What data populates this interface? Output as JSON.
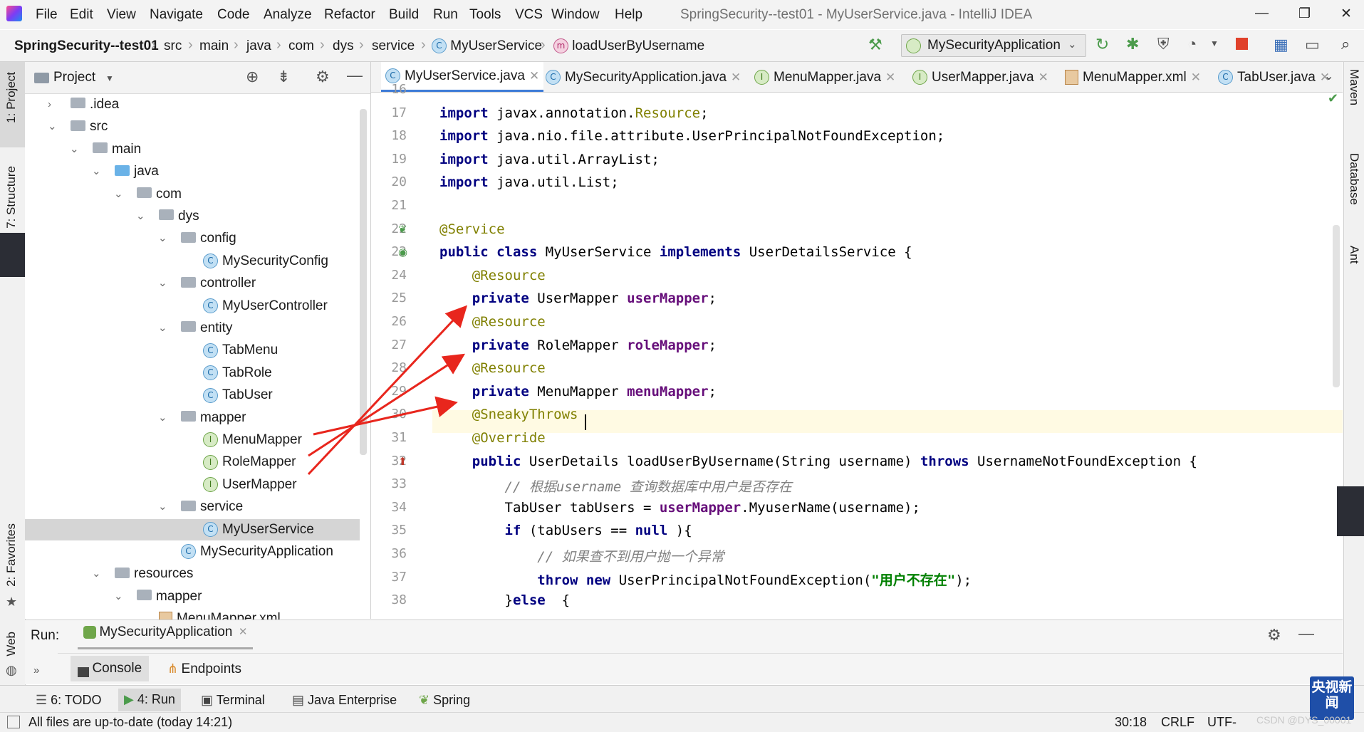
{
  "menu": {
    "items": [
      "File",
      "Edit",
      "View",
      "Navigate",
      "Code",
      "Analyze",
      "Refactor",
      "Build",
      "Run",
      "Tools",
      "VCS",
      "Window",
      "Help"
    ],
    "title": "SpringSecurity--test01 - MyUserService.java - IntelliJ IDEA"
  },
  "window_controls": {
    "minimize": "—",
    "maximize": "❐",
    "close": "✕"
  },
  "breadcrumb": {
    "project": "SpringSecurity--test01",
    "parts": [
      "src",
      "main",
      "java",
      "com",
      "dys",
      "service"
    ],
    "class": "MyUserService",
    "method": "loadUserByUsername"
  },
  "toolbar": {
    "run_config": "MySecurityApplication"
  },
  "left_strip": {
    "project_tab": "1: Project",
    "structure_tab": "7: Structure",
    "favorites_tab": "2: Favorites",
    "web_tab": "Web"
  },
  "right_strip": {
    "maven_tab": "Maven",
    "database_tab": "Database",
    "ant_tab": "Ant"
  },
  "project_panel": {
    "title": "Project",
    "tree": [
      {
        "label": ".idea",
        "kind": "folder",
        "arrow": "›"
      },
      {
        "label": "src",
        "kind": "folder",
        "arrow": "⌄"
      },
      {
        "label": "main",
        "kind": "folder",
        "arrow": "⌄"
      },
      {
        "label": "java",
        "kind": "folder-blue",
        "arrow": "⌄"
      },
      {
        "label": "com",
        "kind": "folder",
        "arrow": "⌄"
      },
      {
        "label": "dys",
        "kind": "folder",
        "arrow": "⌄"
      },
      {
        "label": "config",
        "kind": "folder",
        "arrow": "⌄"
      },
      {
        "label": "MySecurityConfig",
        "kind": "class",
        "arrow": ""
      },
      {
        "label": "controller",
        "kind": "folder",
        "arrow": "⌄"
      },
      {
        "label": "MyUserController",
        "kind": "class",
        "arrow": ""
      },
      {
        "label": "entity",
        "kind": "folder",
        "arrow": "⌄"
      },
      {
        "label": "TabMenu",
        "kind": "class",
        "arrow": ""
      },
      {
        "label": "TabRole",
        "kind": "class",
        "arrow": ""
      },
      {
        "label": "TabUser",
        "kind": "class",
        "arrow": ""
      },
      {
        "label": "mapper",
        "kind": "folder",
        "arrow": "⌄"
      },
      {
        "label": "MenuMapper",
        "kind": "interface",
        "arrow": ""
      },
      {
        "label": "RoleMapper",
        "kind": "interface",
        "arrow": ""
      },
      {
        "label": "UserMapper",
        "kind": "interface",
        "arrow": ""
      },
      {
        "label": "service",
        "kind": "folder",
        "arrow": "⌄"
      },
      {
        "label": "MyUserService",
        "kind": "class",
        "arrow": "",
        "selected": true
      },
      {
        "label": "MySecurityApplication",
        "kind": "class-app",
        "arrow": ""
      },
      {
        "label": "resources",
        "kind": "folder",
        "arrow": "⌄"
      },
      {
        "label": "mapper",
        "kind": "folder",
        "arrow": "⌄"
      },
      {
        "label": "MenuMapper.xml",
        "kind": "xml",
        "arrow": ""
      }
    ]
  },
  "editor_tabs": [
    {
      "label": "MyUserService.java",
      "icon": "C",
      "active": true
    },
    {
      "label": "MySecurityApplication.java",
      "icon": "C"
    },
    {
      "label": "MenuMapper.java",
      "icon": "I"
    },
    {
      "label": "UserMapper.java",
      "icon": "I"
    },
    {
      "label": "MenuMapper.xml",
      "icon": "xml"
    },
    {
      "label": "TabUser.java",
      "icon": "C"
    }
  ],
  "code": {
    "first_line": 16,
    "cursor_line": 30,
    "lines": [
      [],
      [
        [
          "kw",
          "import"
        ],
        [
          "",
          "javax.annotation."
        ],
        [
          "ann",
          "Resource"
        ],
        [
          "",
          ";"
        ]
      ],
      [
        [
          "kw",
          "import"
        ],
        [
          "",
          "java.nio.file.attribute.UserPrincipalNotFoundException;"
        ]
      ],
      [
        [
          "kw",
          "import"
        ],
        [
          "",
          "java.util.ArrayList;"
        ]
      ],
      [
        [
          "kw",
          "import"
        ],
        [
          "",
          "java.util.List;"
        ]
      ],
      [],
      [
        [
          "ann",
          "@Service"
        ]
      ],
      [
        [
          "kw",
          "public class"
        ],
        [
          "",
          "MyUserService "
        ],
        [
          "kw",
          "implements"
        ],
        [
          "",
          "UserDetailsService {"
        ]
      ],
      [
        [
          "",
          "    "
        ],
        [
          "ann",
          "@Resource"
        ]
      ],
      [
        [
          "",
          "    "
        ],
        [
          "kw",
          "private"
        ],
        [
          "",
          "UserMapper "
        ],
        [
          "fld",
          "userMapper"
        ],
        [
          "",
          ";"
        ]
      ],
      [
        [
          "",
          "    "
        ],
        [
          "ann",
          "@Resource"
        ]
      ],
      [
        [
          "",
          "    "
        ],
        [
          "kw",
          "private"
        ],
        [
          "",
          "RoleMapper "
        ],
        [
          "fld",
          "roleMapper"
        ],
        [
          "",
          ";"
        ]
      ],
      [
        [
          "",
          "    "
        ],
        [
          "ann",
          "@Resource"
        ]
      ],
      [
        [
          "",
          "    "
        ],
        [
          "kw",
          "private"
        ],
        [
          "",
          "MenuMapper "
        ],
        [
          "fld",
          "menuMapper"
        ],
        [
          "",
          ";"
        ]
      ],
      [
        [
          "",
          "    "
        ],
        [
          "ann",
          "@SneakyThrows"
        ]
      ],
      [
        [
          "",
          "    "
        ],
        [
          "ann",
          "@Override"
        ]
      ],
      [
        [
          "",
          "    "
        ],
        [
          "kw",
          "public"
        ],
        [
          "",
          "UserDetails loadUserByUsername(String username) "
        ],
        [
          "kw",
          "throws"
        ],
        [
          "",
          "UsernameNotFoundException {"
        ]
      ],
      [
        [
          "",
          "        "
        ],
        [
          "cmt",
          "// 根据username 查询数据库中用户是否存在"
        ]
      ],
      [
        [
          "",
          "        TabUser tabUsers = "
        ],
        [
          "fld",
          "userMapper"
        ],
        [
          "",
          ".MyuserName(username);"
        ]
      ],
      [
        [
          "",
          "        "
        ],
        [
          "kw",
          "if"
        ],
        [
          "",
          "(tabUsers == "
        ],
        [
          "kw",
          "null"
        ],
        [
          "",
          "){"
        ]
      ],
      [
        [
          "",
          "            "
        ],
        [
          "cmt",
          "// 如果查不到用户抛一个异常"
        ]
      ],
      [
        [
          "",
          "            "
        ],
        [
          "kw",
          "throw new"
        ],
        [
          "",
          "UserPrincipalNotFoundException("
        ],
        [
          "str",
          "\"用户不存在\""
        ],
        [
          "",
          ");"
        ]
      ],
      [
        [
          "",
          "        }"
        ],
        [
          "kw",
          "else"
        ],
        [
          "",
          " {"
        ]
      ]
    ]
  },
  "run_panel": {
    "label": "Run:",
    "config": "MySecurityApplication",
    "console_tab": "Console",
    "endpoints_tab": "Endpoints"
  },
  "bottom_tabs": [
    "6: TODO",
    "4: Run",
    "Terminal",
    "Java Enterprise",
    "Spring"
  ],
  "status": {
    "message": "All files are up-to-date (today 14:21)",
    "position": "30:18",
    "line_sep": "CRLF",
    "encoding": "UTF-"
  },
  "watermark": {
    "csdn": "CSDN @DYS_00001",
    "cctv": "央视新闻"
  },
  "colors": {
    "arrow": "#e8261d",
    "accent": "#3d7bd7",
    "keyword": "#000080",
    "annotation": "#808000"
  }
}
